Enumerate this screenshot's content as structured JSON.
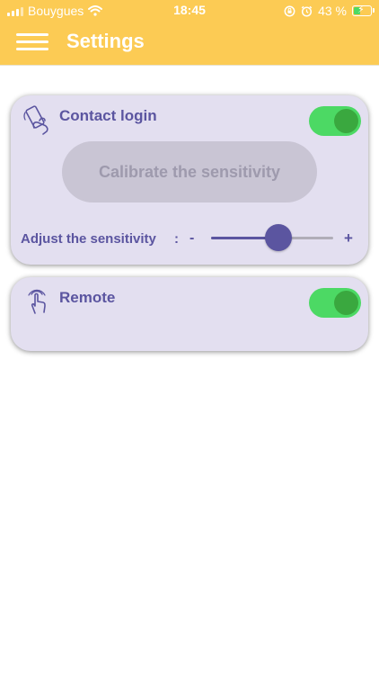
{
  "status_bar": {
    "carrier": "Bouygues",
    "time": "18:45",
    "battery_percent": "43 %",
    "battery_level": 0.43
  },
  "header": {
    "title": "Settings",
    "menu_icon": "hamburger-menu-icon",
    "background_color": "#fccb54"
  },
  "contact_card": {
    "icon": "phone-in-hand-icon",
    "label": "Contact login",
    "toggle_on": true,
    "calibrate_label": "Calibrate the sensitivity",
    "sensitivity_label": "Adjust the sensitivity",
    "colon": ":",
    "minus": "-",
    "plus": "+",
    "sensitivity_value": 0.55
  },
  "remote_card": {
    "icon": "touch-finger-icon",
    "label": "Remote",
    "toggle_on": true
  },
  "colors": {
    "accent": "#5b55a0",
    "toggle_on": "#4cd964",
    "card_background": "#e3dff0"
  }
}
